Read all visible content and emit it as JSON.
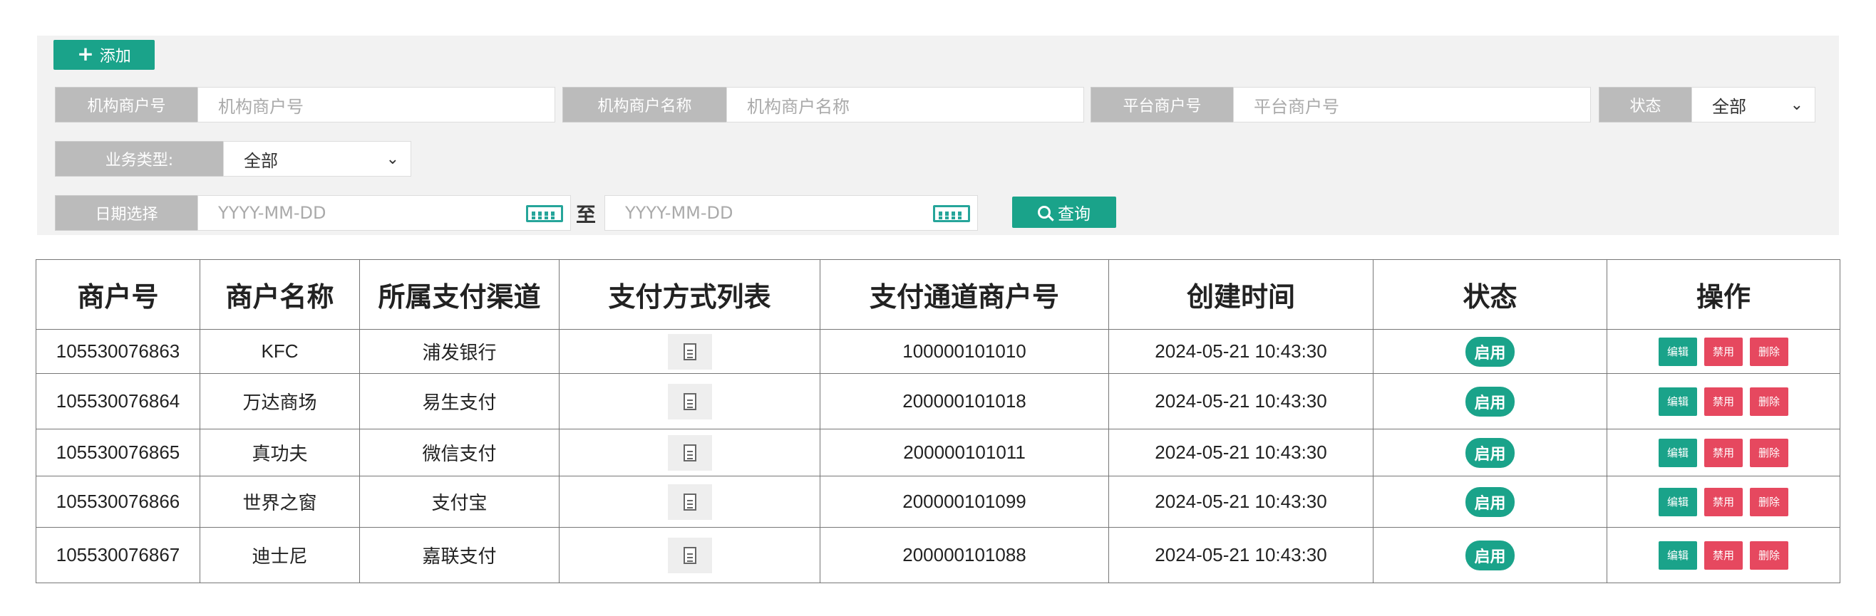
{
  "toolbar": {
    "add_label": "添加"
  },
  "filters": {
    "org_merchant_no": {
      "label": "机构商户号",
      "placeholder": "机构商户号"
    },
    "org_merchant_name": {
      "label": "机构商户名称",
      "placeholder": "机构商户名称"
    },
    "platform_merchant_no": {
      "label": "平台商户号",
      "placeholder": "平台商户号"
    },
    "status": {
      "label": "状态",
      "value": "全部"
    },
    "business_type": {
      "label": "业务类型:",
      "value": "全部"
    },
    "date": {
      "label": "日期选择",
      "start_placeholder": "YYYY-MM-DD",
      "separator": "至",
      "end_placeholder": "YYYY-MM-DD"
    },
    "query_label": "查询"
  },
  "table": {
    "headers": [
      "商户号",
      "商户名称",
      "所属支付渠道",
      "支付方式列表",
      "支付通道商户号",
      "创建时间",
      "状态",
      "操作"
    ],
    "rows": [
      {
        "merchant_no": "105530076863",
        "name": "KFC",
        "channel": "浦发银行",
        "channel_merchant_no": "100000101010",
        "created": "2024-05-21 10:43:30",
        "status": "启用"
      },
      {
        "merchant_no": "105530076864",
        "name": "万达商场",
        "channel": "易生支付",
        "channel_merchant_no": "200000101018",
        "created": "2024-05-21 10:43:30",
        "status": "启用"
      },
      {
        "merchant_no": "105530076865",
        "name": "真功夫",
        "channel": "微信支付",
        "channel_merchant_no": "200000101011",
        "created": "2024-05-21 10:43:30",
        "status": "启用"
      },
      {
        "merchant_no": "105530076866",
        "name": "世界之窗",
        "channel": "支付宝",
        "channel_merchant_no": "200000101099",
        "created": "2024-05-21 10:43:30",
        "status": "启用"
      },
      {
        "merchant_no": "105530076867",
        "name": "迪士尼",
        "channel": "嘉联支付",
        "channel_merchant_no": "200000101088",
        "created": "2024-05-21 10:43:30",
        "status": "启用"
      }
    ],
    "actions": {
      "edit": "编辑",
      "disable": "禁用",
      "delete": "删除"
    }
  },
  "colors": {
    "accent": "#1aa38a",
    "danger": "#e6485f"
  }
}
